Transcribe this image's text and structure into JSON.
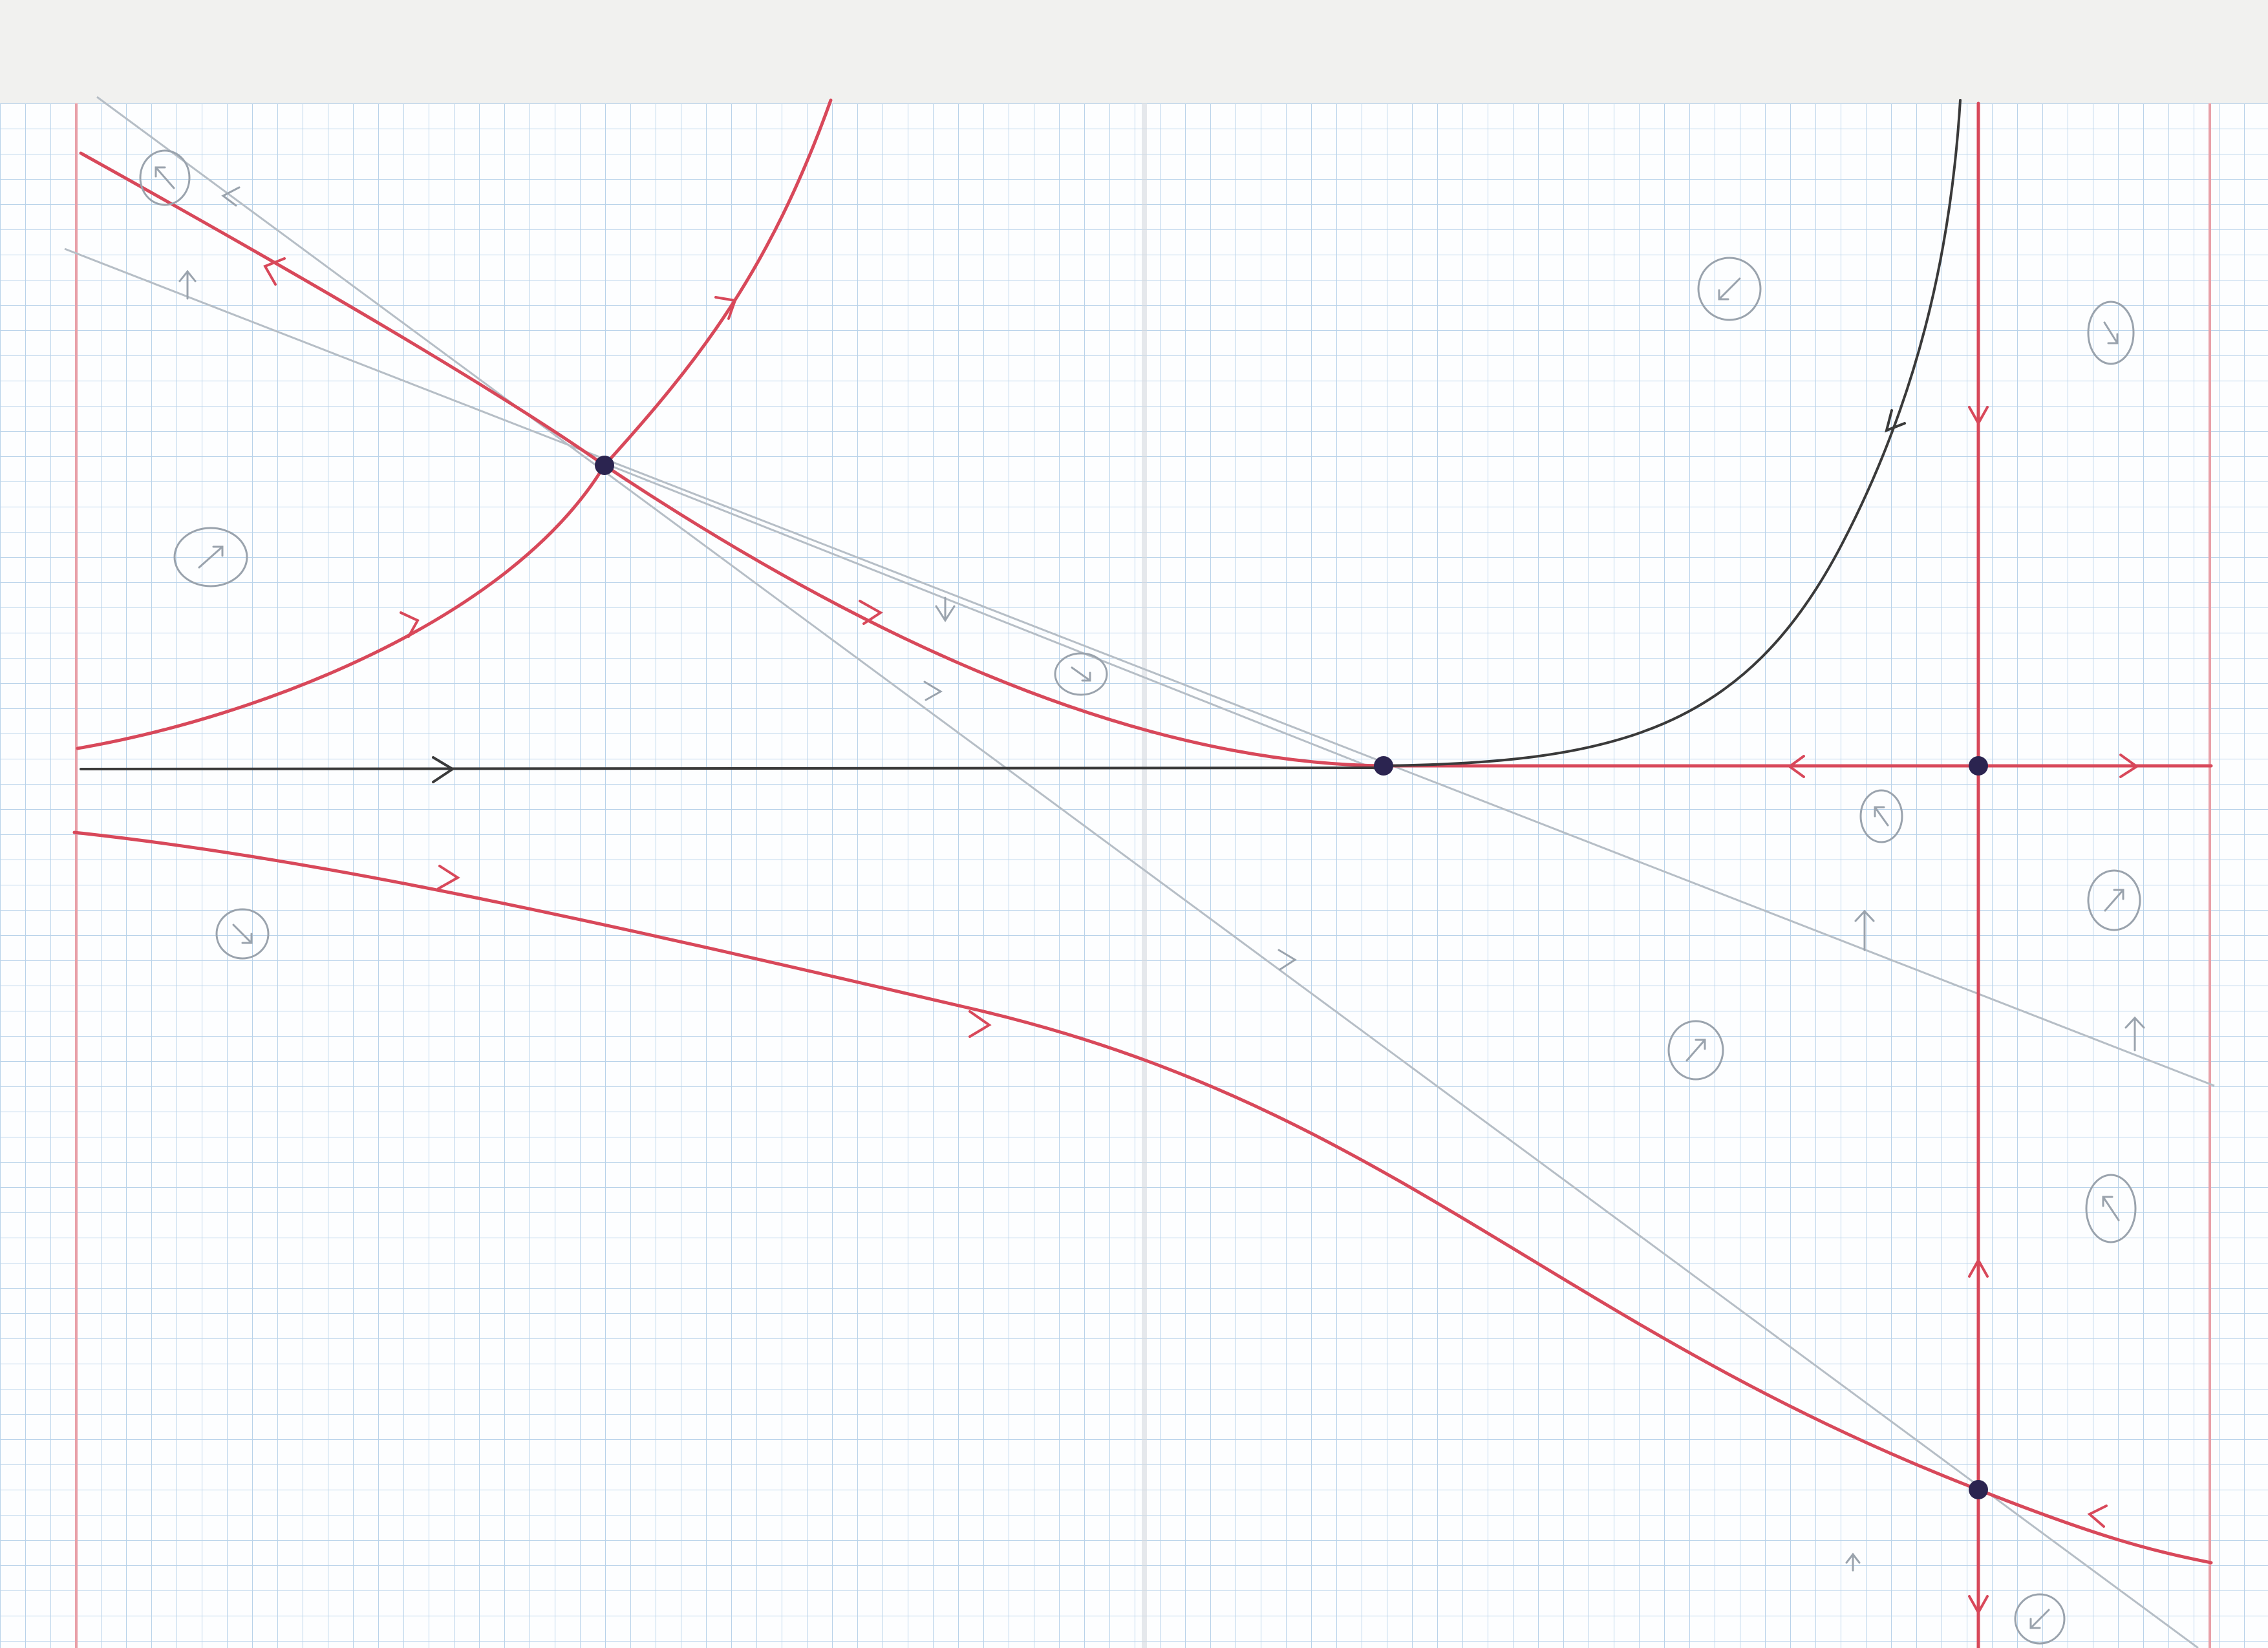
{
  "paper": {
    "background": "#fdfeff",
    "grid_color": "#b9d3ea",
    "margin_color": "#e8a0a8",
    "fold_color": "#d6dbe0"
  },
  "ink": {
    "red": "#d8485a",
    "black": "#3a3a3a",
    "pencil": "#b6bec6",
    "point": "#2b2450"
  },
  "diagram": {
    "title": "",
    "fixed_points": [
      {
        "name": "equilibrium-upper-left"
      },
      {
        "name": "equilibrium-middle"
      },
      {
        "name": "equilibrium-right"
      },
      {
        "name": "equilibrium-lower-right"
      }
    ],
    "trajectory_colors": [
      "red",
      "black"
    ],
    "region_markers": [
      "arrow-up-left",
      "arrow-up-right",
      "arrow-down-right",
      "arrow-down-left"
    ]
  }
}
